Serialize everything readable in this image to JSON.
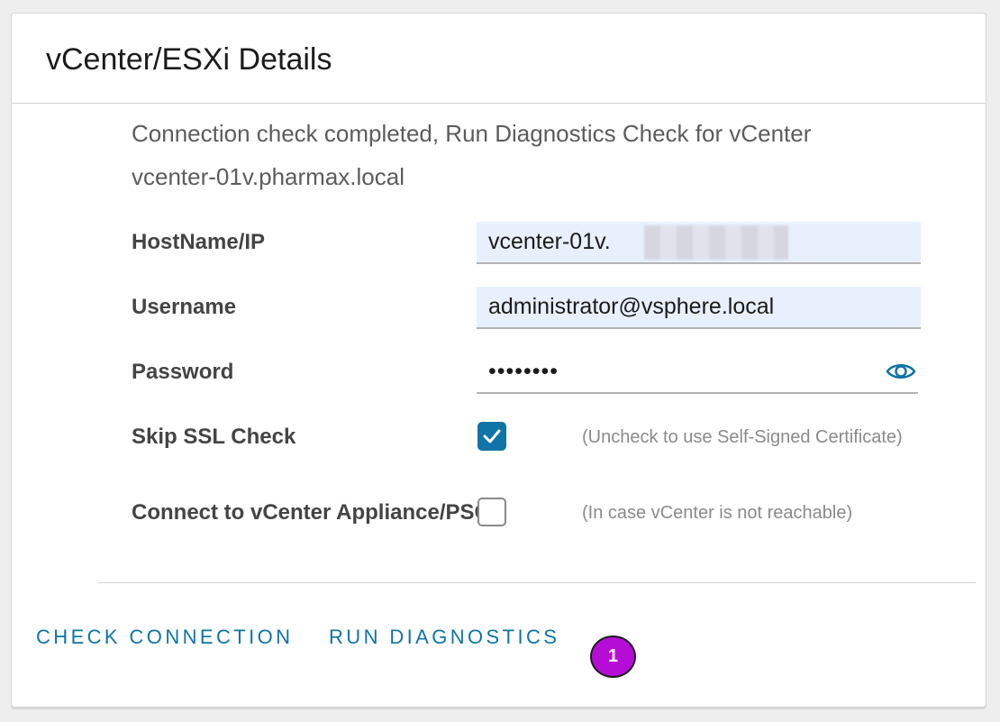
{
  "card": {
    "title": "vCenter/ESXi Details"
  },
  "status": {
    "line1": "Connection check completed, Run Diagnostics Check for vCenter",
    "line2": "vcenter-01v.pharmax.local"
  },
  "fields": {
    "hostname_label": "HostName/IP",
    "hostname_value": "vcenter-01v.",
    "username_label": "Username",
    "username_value": "administrator@vsphere.local",
    "password_label": "Password",
    "password_value": "••••••••",
    "skip_ssl_label": "Skip SSL Check",
    "skip_ssl_checked": true,
    "skip_ssl_hint": "(Uncheck to use Self-Signed Certificate)",
    "connect_label": "Connect to vCenter Appliance/PSC",
    "connect_checked": false,
    "connect_hint": "(In case vCenter is not reachable)"
  },
  "actions": {
    "check_connection": "CHECK CONNECTION",
    "run_diagnostics": "RUN DIAGNOSTICS"
  },
  "annotation": {
    "step": "1"
  },
  "icons": {
    "password_toggle": "eye-icon",
    "checkbox_checked": "checkmark-icon"
  },
  "colors": {
    "accent": "#0f74a6",
    "input_autofill_bg": "#e8f0fe",
    "badge": "#b60dd6"
  }
}
